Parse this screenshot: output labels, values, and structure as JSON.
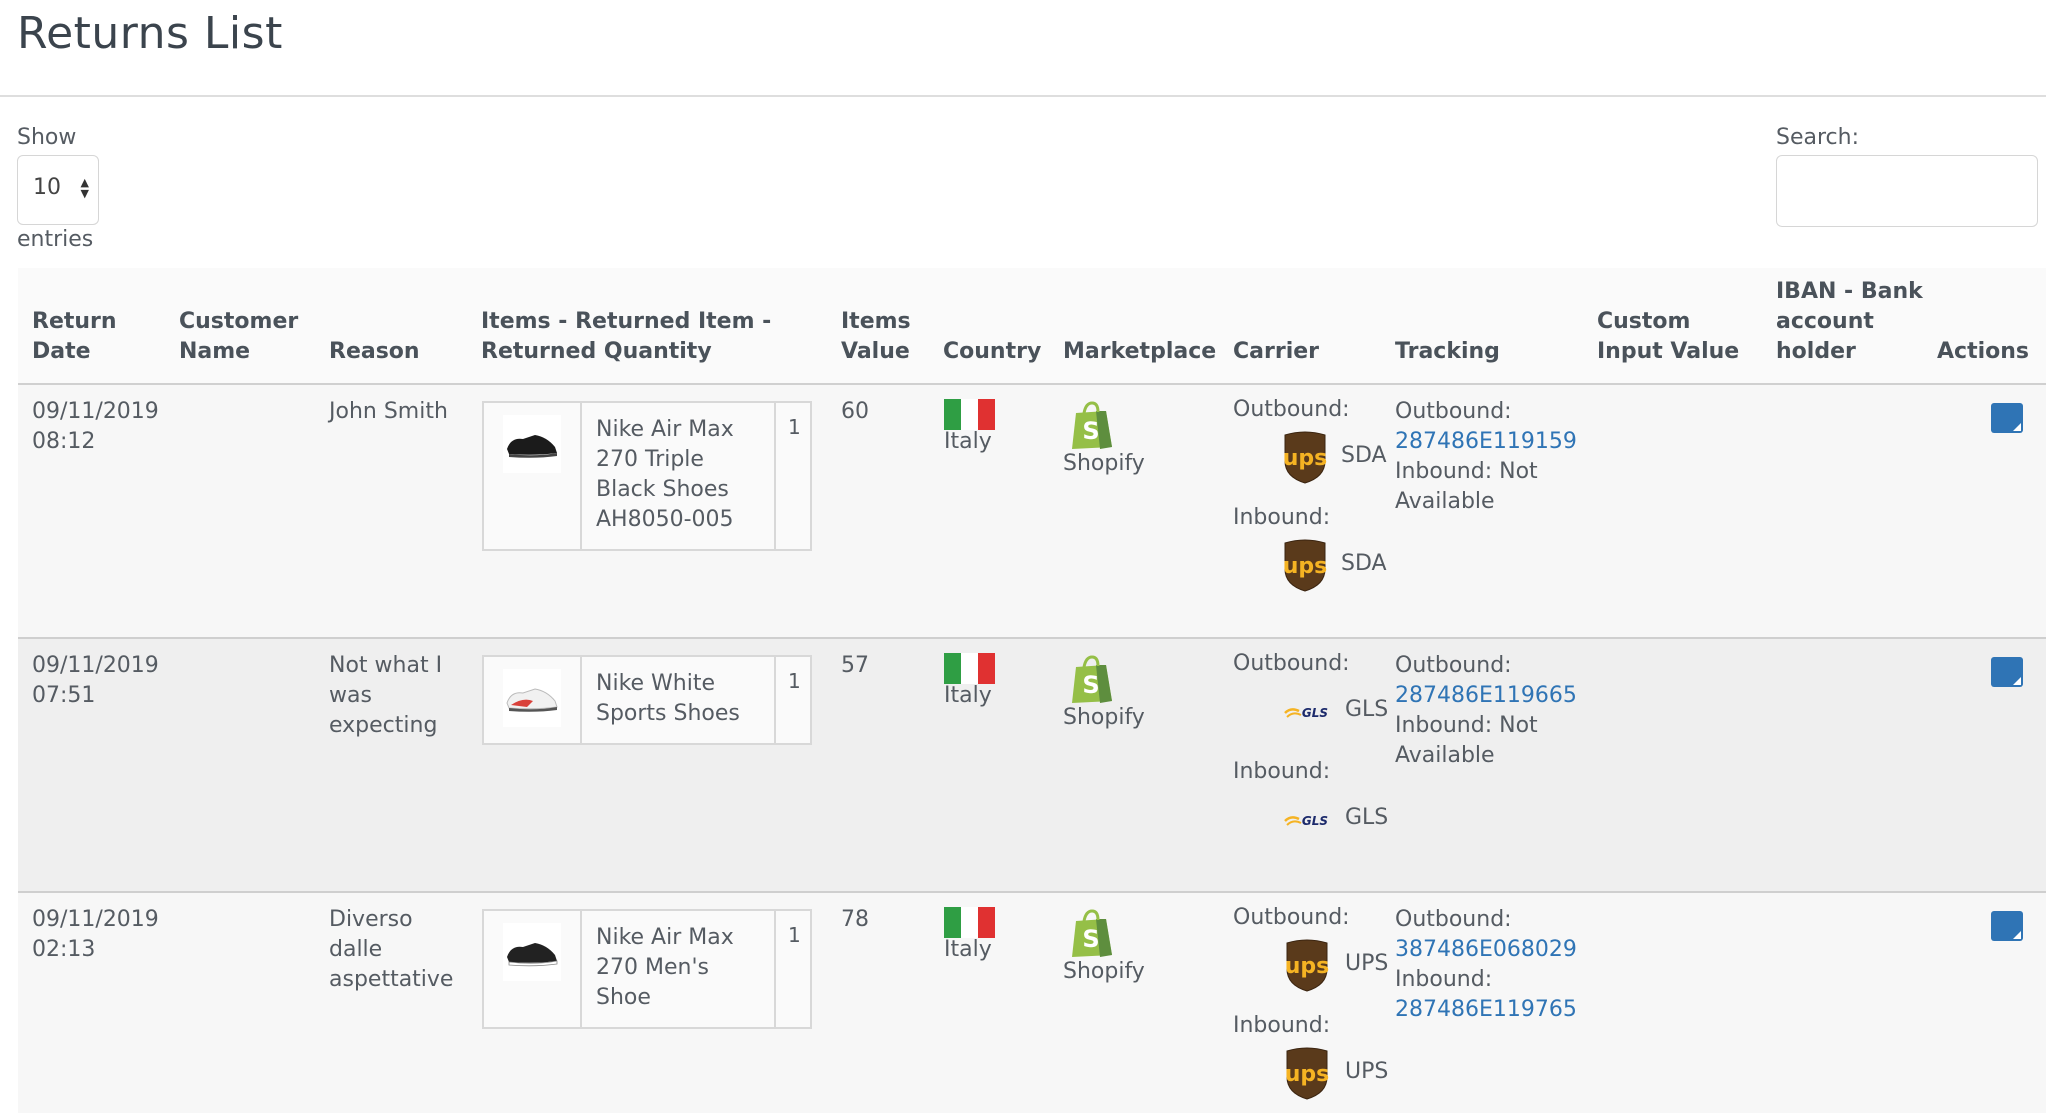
{
  "page": {
    "title": "Returns List"
  },
  "controls": {
    "show_label": "Show",
    "show_value": "10",
    "entries_label": "entries",
    "search_label": "Search:",
    "search_value": ""
  },
  "table": {
    "headers": {
      "return_date": [
        "Return",
        "Date"
      ],
      "customer_name": [
        "Customer",
        "Name"
      ],
      "reason": [
        "Reason"
      ],
      "items": [
        "Items - Returned Item -",
        "Returned Quantity"
      ],
      "items_value": [
        "Items",
        "Value"
      ],
      "country": [
        "Country"
      ],
      "marketplace": [
        "Marketplace"
      ],
      "carrier": [
        "Carrier"
      ],
      "tracking": [
        "Tracking"
      ],
      "custom_input": [
        "Custom",
        "Input Value"
      ],
      "iban": [
        "IBAN - Bank",
        "account",
        "holder"
      ],
      "actions": [
        "Actions"
      ]
    },
    "rows": [
      {
        "date": [
          "09/11/2019",
          "08:12"
        ],
        "customer": "",
        "reason": [
          "John Smith"
        ],
        "item_name": [
          "Nike Air Max",
          "270 Triple",
          "Black Shoes",
          "AH8050-005"
        ],
        "item_qty": "1",
        "value": "60",
        "country": "Italy",
        "marketplace": "Shopify",
        "outbound_label": "Outbound:",
        "outbound_carrier": "SDA",
        "outbound_logo": "ups-logo",
        "inbound_label": "Inbound:",
        "inbound_carrier": "SDA",
        "inbound_logo": "ups-logo",
        "tracking_outbound_label": "Outbound:",
        "tracking_outbound": "287486E119159",
        "tracking_inbound_label": "Inbound: Not",
        "tracking_inbound": "Available"
      },
      {
        "date": [
          "09/11/2019",
          "07:51"
        ],
        "customer": "",
        "reason": [
          "Not what I",
          "was",
          "expecting"
        ],
        "item_name": [
          "Nike White",
          "Sports Shoes"
        ],
        "item_qty": "1",
        "value": "57",
        "country": "Italy",
        "marketplace": "Shopify",
        "outbound_label": "Outbound:",
        "outbound_carrier": "GLS",
        "outbound_logo": "gls-logo",
        "inbound_label": "Inbound:",
        "inbound_carrier": "GLS",
        "inbound_logo": "gls-logo",
        "tracking_outbound_label": "Outbound:",
        "tracking_outbound": "287486E119665",
        "tracking_inbound_label": "Inbound: Not",
        "tracking_inbound": "Available"
      },
      {
        "date": [
          "09/11/2019",
          "02:13"
        ],
        "customer": "",
        "reason": [
          "Diverso",
          "dalle",
          "aspettative"
        ],
        "item_name": [
          "Nike Air Max",
          "270 Men's",
          "Shoe"
        ],
        "item_qty": "1",
        "value": "78",
        "country": "Italy",
        "marketplace": "Shopify",
        "outbound_label": "Outbound:",
        "outbound_carrier": "UPS",
        "outbound_logo": "ups-logo",
        "inbound_label": "Inbound:",
        "inbound_carrier": "UPS",
        "inbound_logo": "ups-logo",
        "tracking_outbound_label": "Outbound:",
        "tracking_outbound": "387486E068029",
        "tracking_inbound_label": "Inbound:",
        "tracking_inbound": "287486E119765"
      }
    ]
  },
  "colors": {
    "link": "#2f74b5",
    "flag_green": "#2f9e44",
    "flag_white": "#ffffff",
    "flag_red": "#e03131",
    "shopify_green": "#95bf47",
    "ups_brown": "#5a3a1b",
    "ups_gold": "#f5b323"
  },
  "icons": {
    "shopify": "shopify-bag-icon",
    "edit": "edit-note-icon",
    "flag": "italy-flag-icon"
  }
}
